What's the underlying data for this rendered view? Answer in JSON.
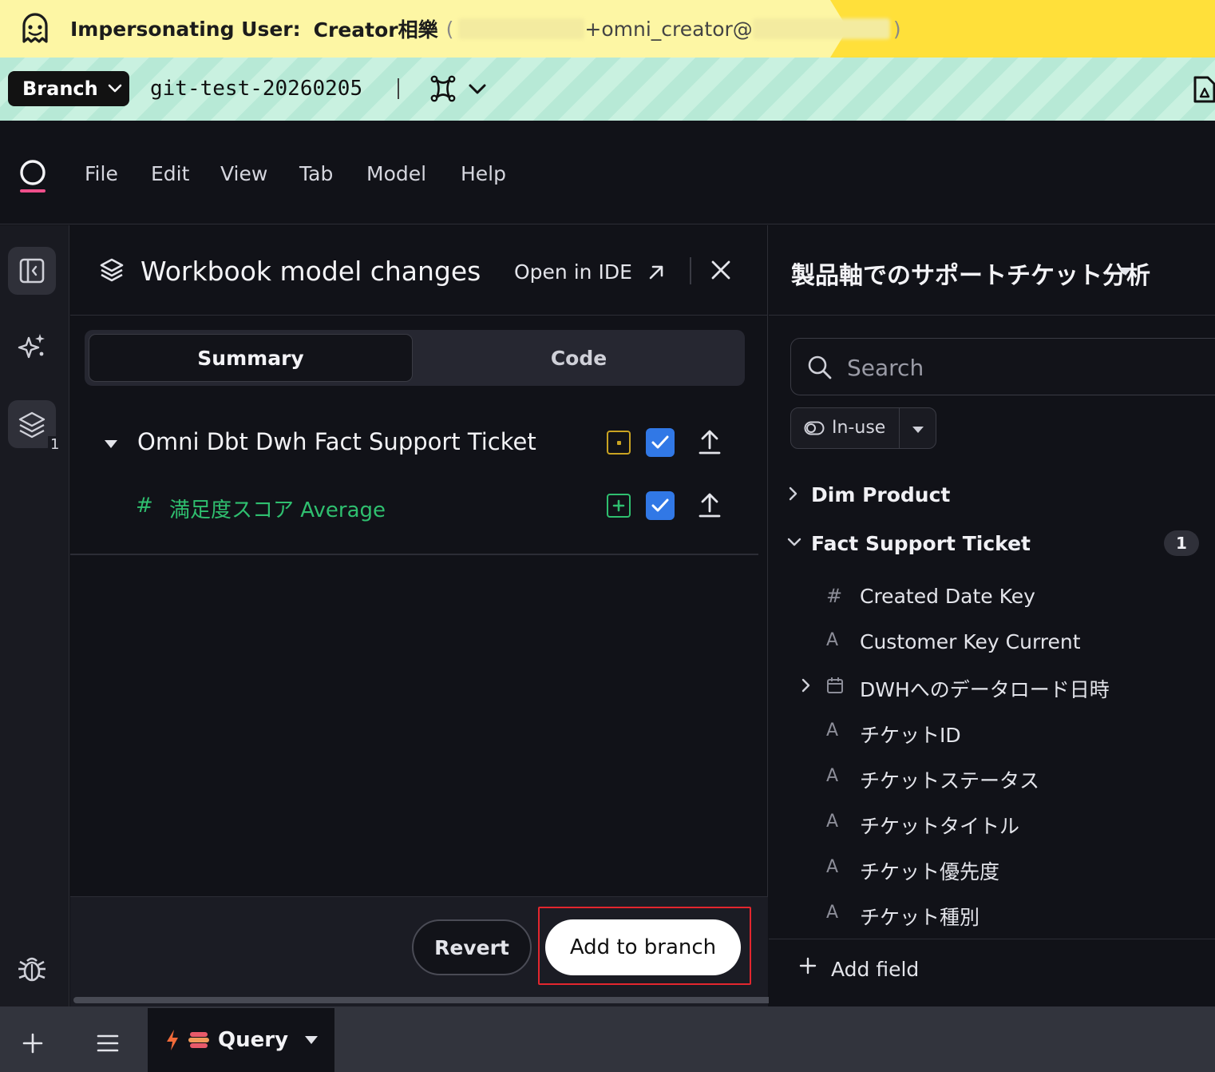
{
  "impersonation": {
    "label": "Impersonating User:",
    "user_name": "Creator相樂",
    "paren_open": "(",
    "email_fragment": "+omni_creator@",
    "paren_close": ")"
  },
  "branch_bar": {
    "button_label": "Branch",
    "branch_name": "git-test-20260205"
  },
  "menu": [
    "File",
    "Edit",
    "View",
    "Tab",
    "Model",
    "Help"
  ],
  "rail": {
    "changes_badge": "1"
  },
  "changes_panel": {
    "title": "Workbook model changes",
    "open_in_ide": "Open in IDE",
    "tabs": {
      "summary": "Summary",
      "code": "Code"
    },
    "tree": {
      "view_name": "Omni Dbt Dwh Fact Support Ticket",
      "field_hash": "#",
      "field_name": "満足度スコア Average"
    },
    "revert_label": "Revert",
    "add_to_branch_label": "Add to branch"
  },
  "field_panel": {
    "topic_title": "製品軸でのサポートチケット分析",
    "search_placeholder": "Search",
    "filter_label": "In-use",
    "views": [
      {
        "name": "Dim Product"
      },
      {
        "name": "Fact Support Ticket",
        "count": "1"
      }
    ],
    "fields": [
      {
        "icon": "#",
        "name": "Created Date Key"
      },
      {
        "icon": "A",
        "name": "Customer Key Current"
      },
      {
        "icon": "cal",
        "name": "DWHへのデータロード日時"
      },
      {
        "icon": "A",
        "name": "チケットID"
      },
      {
        "icon": "A",
        "name": "チケットステータス"
      },
      {
        "icon": "A",
        "name": "チケットタイトル"
      },
      {
        "icon": "A",
        "name": "チケット優先度"
      },
      {
        "icon": "A",
        "name": "チケット種別"
      }
    ],
    "add_field_label": "Add field"
  },
  "bottom_bar": {
    "tab_label": "Query"
  }
}
